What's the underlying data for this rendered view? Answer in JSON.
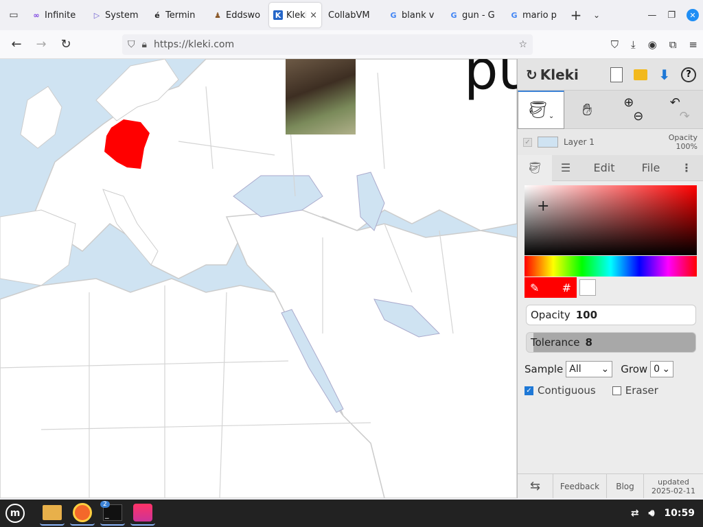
{
  "browser": {
    "tabs": [
      {
        "label": "Infinite",
        "favicon": "∞"
      },
      {
        "label": "System",
        "favicon": "▷"
      },
      {
        "label": "Termin",
        "favicon": "é"
      },
      {
        "label": "Eddswo",
        "favicon": "♟"
      },
      {
        "label": "Kleki",
        "favicon": "K",
        "active": true
      },
      {
        "label": "CollabVM",
        "favicon": ""
      },
      {
        "label": "blank v",
        "favicon": "G"
      },
      {
        "label": "gun - G",
        "favicon": "G"
      },
      {
        "label": "mario p",
        "favicon": "G"
      }
    ],
    "url": "https://kleki.com",
    "close_tab": "×"
  },
  "canvas": {
    "text_fragment": "pu",
    "highlight_color": "#ff0000"
  },
  "kleki": {
    "logo": "Kleki",
    "layer_name": "Layer 1",
    "layer_opacity_label": "Opacity",
    "layer_opacity_value": "100%",
    "menu": {
      "edit": "Edit",
      "file": "File"
    },
    "color_hash": "#",
    "opacity_label": "Opacity",
    "opacity_value": "100",
    "tolerance_label": "Tolerance",
    "tolerance_value": "8",
    "sample_label": "Sample",
    "sample_value": "All",
    "grow_label": "Grow",
    "grow_value": "0",
    "contiguous": "Contiguous",
    "eraser": "Eraser",
    "footer": {
      "feedback": "Feedback",
      "blog": "Blog",
      "updated": "updated",
      "date": "2025-02-11"
    }
  },
  "taskbar": {
    "time": "10:59",
    "badge": "2"
  }
}
